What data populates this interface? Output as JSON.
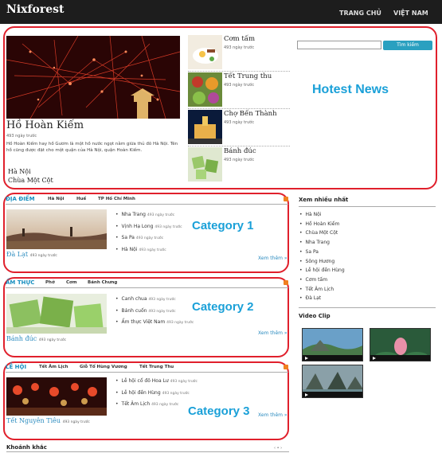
{
  "header": {
    "logo": "Nixforest",
    "nav": [
      "TRANG CHỦ",
      "VIỆT NAM"
    ]
  },
  "hotest": {
    "annotation": "Hotest News",
    "main": {
      "title": "Hồ Hoàn Kiếm",
      "time": "493 ngày trước",
      "desc": "Hồ Hoàn Kiếm hay hồ Gươm là một hồ nước ngọt nằm giữa thủ đô Hà Nội. Tên hồ cũng được đặt cho một quận của Hà Nội, quận Hoàn Kiếm.",
      "links": [
        "Hà Nội",
        "Chùa Một Cột"
      ]
    },
    "side": [
      {
        "title": "Cơm tấm",
        "time": "493 ngày trước"
      },
      {
        "title": "Tết Trung thu",
        "time": "493 ngày trước"
      },
      {
        "title": "Chợ Bến Thành",
        "time": "493 ngày trước"
      },
      {
        "title": "Bánh đúc",
        "time": "493 ngày trước"
      }
    ]
  },
  "search": {
    "placeholder": "",
    "button": "Tìm kiếm"
  },
  "categories": [
    {
      "annotation": "Category 1",
      "name": "ĐỊA ĐIỂM",
      "subs": [
        "Hà Nội",
        "Huế",
        "TP Hồ Chí Minh"
      ],
      "caption": "Đà Lạt",
      "caption_time": "493 ngày trước",
      "items": [
        {
          "title": "Nha Trang",
          "time": "493 ngày trước"
        },
        {
          "title": "Vịnh Hạ Long",
          "time": "493 ngày trước"
        },
        {
          "title": "Sa Pa",
          "time": "493 ngày trước"
        },
        {
          "title": "Hà Nội",
          "time": "493 ngày trước"
        }
      ],
      "more": "Xem thêm »"
    },
    {
      "annotation": "Category 2",
      "name": "ẨM THỰC",
      "subs": [
        "Phở",
        "Cơm",
        "Bánh Chưng"
      ],
      "caption": "Bánh đúc",
      "caption_time": "493 ngày trước",
      "items": [
        {
          "title": "Canh chua",
          "time": "493 ngày trước"
        },
        {
          "title": "Bánh cuốn",
          "time": "493 ngày trước"
        },
        {
          "title": "Ẩm thực Việt Nam",
          "time": "493 ngày trước"
        }
      ],
      "more": "Xem thêm »"
    },
    {
      "annotation": "Category 3",
      "name": "LỄ HỘI",
      "subs": [
        "Tết Âm Lịch",
        "Giỗ Tổ Hùng Vương",
        "Tết Trung Thu"
      ],
      "caption": "Tết Nguyên Tiêu",
      "caption_time": "493 ngày trước",
      "items": [
        {
          "title": "Lễ hội cổ đô Hoa Lư",
          "time": "493 ngày trước"
        },
        {
          "title": "Lễ hội đền Hùng",
          "time": "493 ngày trước"
        },
        {
          "title": "Tết Âm Lịch",
          "time": "493 ngày trước"
        }
      ],
      "more": "Xem thêm »"
    }
  ],
  "sidebar": {
    "popular_title": "Xem nhiều nhất",
    "popular": [
      "Hà Nội",
      "Hồ Hoàn Kiếm",
      "Chùa Một Cột",
      "Nha Trang",
      "Sa Pa",
      "Sông Hương",
      "Lễ hội đền Hùng",
      "Cơm tấm",
      "Tết Âm Lịch",
      "Đà Lạt"
    ],
    "video_title": "Video Clip"
  },
  "bottom": {
    "title": "Khoảnh khắc",
    "pager": "‹ • ›"
  },
  "colors": {
    "accent": "#1a8fc0",
    "annotation": "#1aa0d8",
    "highlight_border": "#e0202c",
    "topbar": "#1d1d1d"
  }
}
